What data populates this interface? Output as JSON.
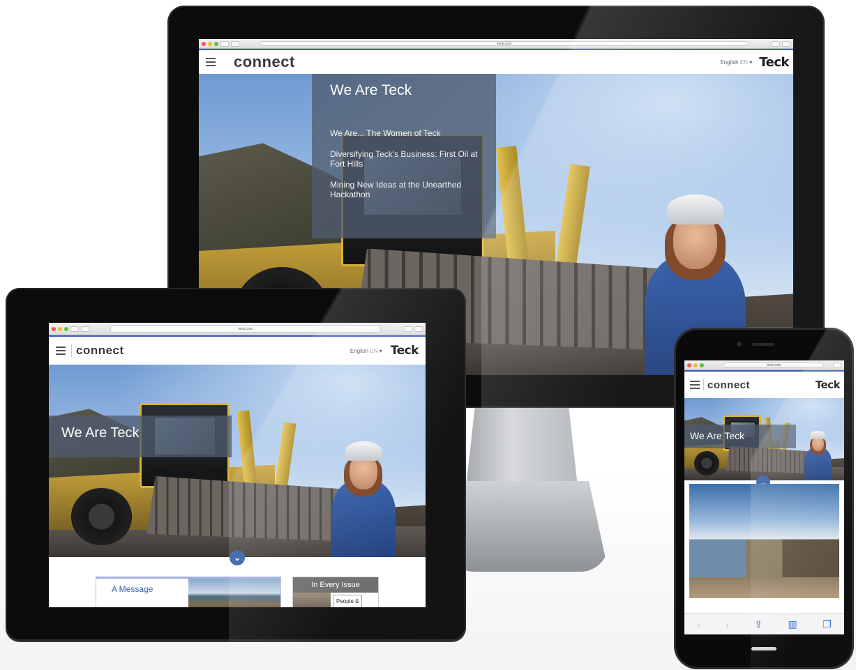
{
  "browser": {
    "url": "teck.com"
  },
  "site": {
    "logo": "connect",
    "language": "English",
    "language_code": "EN",
    "language_caret": "▾",
    "brand": "Teck"
  },
  "monitor": {
    "panel_title": "We Are Teck",
    "links": [
      "We Are... The Women of Teck",
      "Diversifying Teck's Business: First Oil at Fort Hills",
      "Mining New Ideas at the Unearthed Hackathon"
    ]
  },
  "tablet": {
    "panel_title": "We Are Teck",
    "chevron": "⌄",
    "card_message": "A Message",
    "card_issue_title": "In Every Issue",
    "card_issue_item": "People &"
  },
  "phone": {
    "panel_title": "We Are Teck",
    "chevron": "⌄",
    "toolbar": {
      "back": "‹",
      "forward": "›",
      "share": "⇪",
      "bookmarks": "▥",
      "tabs": "❐"
    }
  },
  "colors": {
    "accent_blue": "#2e5aa5",
    "header_rule": "#3b5bb5",
    "panel_overlay": "#505c70"
  }
}
